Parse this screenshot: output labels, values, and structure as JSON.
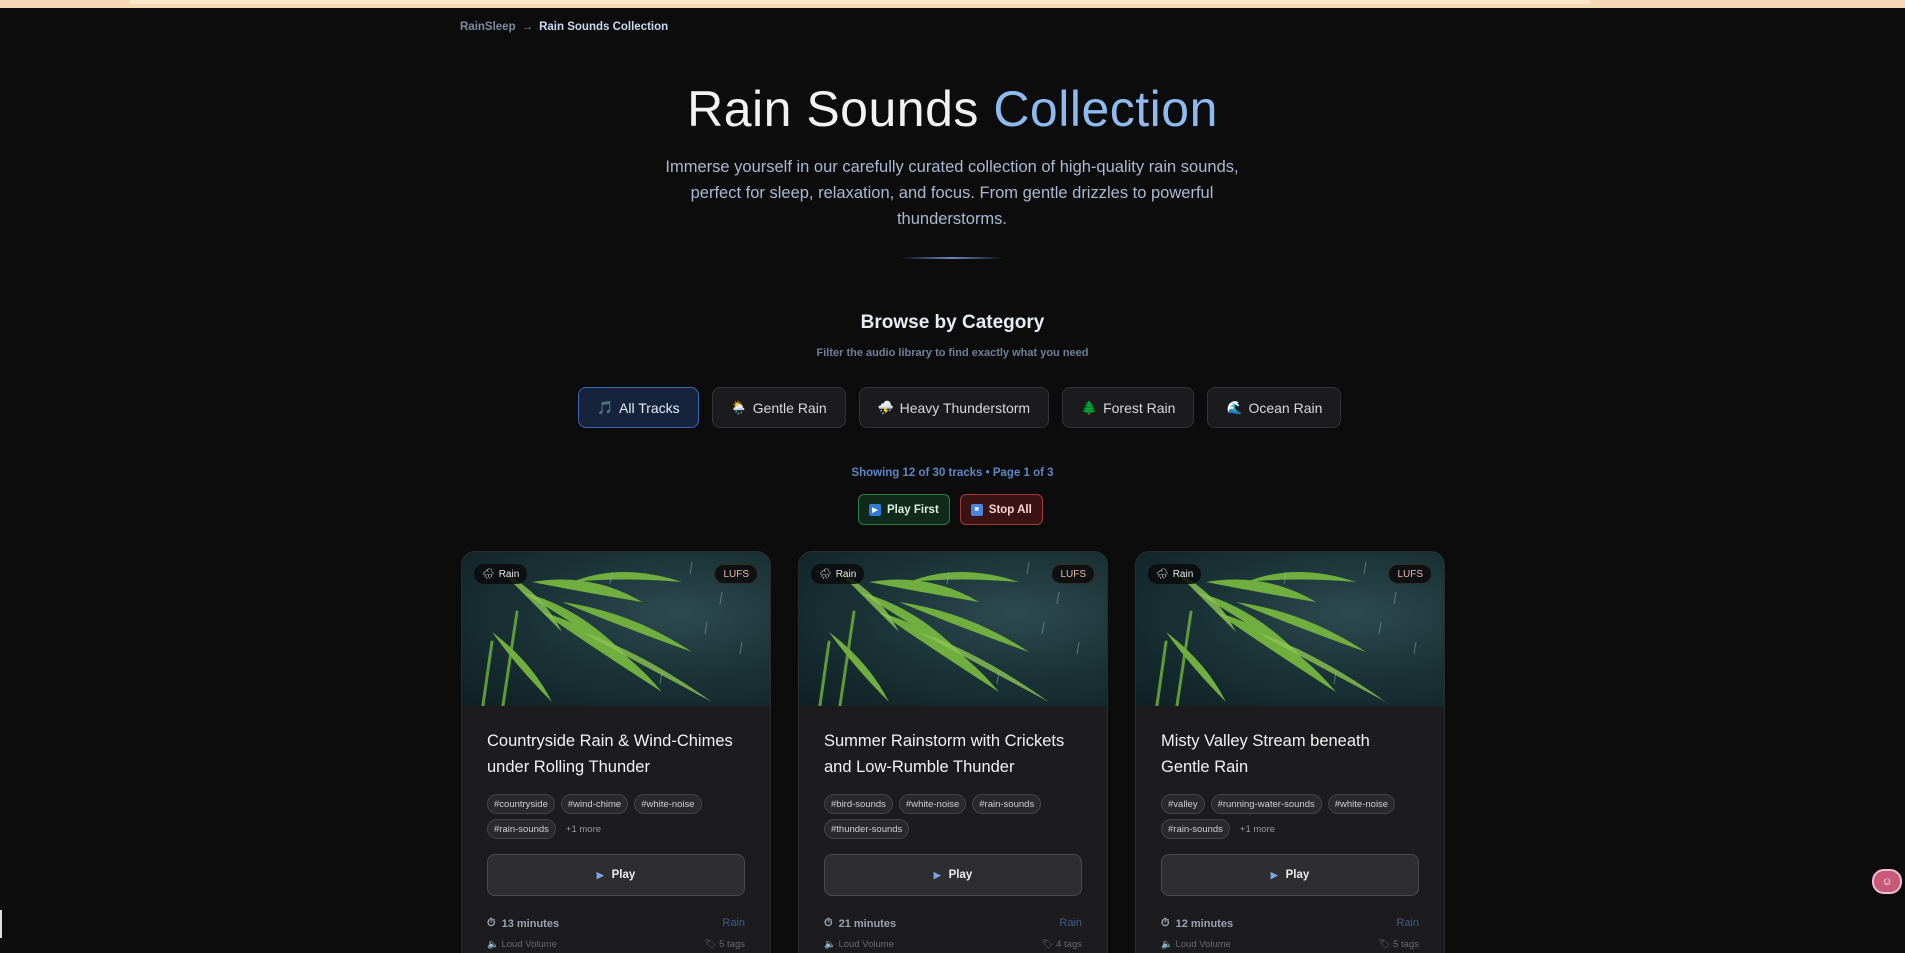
{
  "breadcrumb": {
    "home": "RainSleep",
    "separator": "→",
    "current": "Rain Sounds Collection"
  },
  "hero": {
    "title_main": "Rain Sounds",
    "title_accent": "Collection",
    "description": "Immerse yourself in our carefully curated collection of high-quality rain sounds, perfect for sleep, relaxation, and focus. From gentle drizzles to powerful thunderstorms."
  },
  "browse": {
    "title": "Browse by Category",
    "subtitle": "Filter the audio library to find exactly what you need",
    "categories": [
      {
        "icon": "🎵",
        "label": "All Tracks"
      },
      {
        "icon": "🌦️",
        "label": "Gentle Rain"
      },
      {
        "icon": "⛈️",
        "label": "Heavy Thunderstorm"
      },
      {
        "icon": "🌲",
        "label": "Forest Rain"
      },
      {
        "icon": "🌊",
        "label": "Ocean Rain"
      }
    ]
  },
  "status": {
    "showing": "Showing 12 of 30 tracks • Page 1 of 3"
  },
  "controls": {
    "play_first": "Play First",
    "stop_all": "Stop All"
  },
  "cards": [
    {
      "type_badge": "Rain",
      "lufs": "LUFS",
      "title": "Countryside Rain & Wind-Chimes under Rolling Thunder",
      "tags": [
        "#countryside",
        "#wind-chime",
        "#white-noise",
        "#rain-sounds"
      ],
      "more": "+1 more",
      "play": "Play",
      "duration": "13 minutes",
      "category": "Rain",
      "volume": "Loud Volume",
      "tag_count": "5 tags"
    },
    {
      "type_badge": "Rain",
      "lufs": "LUFS",
      "title": "Summer Rainstorm with Crickets and Low-Rumble Thunder",
      "tags": [
        "#bird-sounds",
        "#white-noise",
        "#rain-sounds",
        "#thunder-sounds"
      ],
      "more": "",
      "play": "Play",
      "duration": "21 minutes",
      "category": "Rain",
      "volume": "Loud Volume",
      "tag_count": "4 tags"
    },
    {
      "type_badge": "Rain",
      "lufs": "LUFS",
      "title": "Misty Valley Stream beneath Gentle Rain",
      "tags": [
        "#valley",
        "#running-water-sounds",
        "#white-noise",
        "#rain-sounds"
      ],
      "more": "+1 more",
      "play": "Play",
      "duration": "12 minutes",
      "category": "Rain",
      "volume": "Loud Volume",
      "tag_count": "5 tags"
    }
  ],
  "colors": {
    "accent": "#8fbaf0",
    "background": "#0c0c0c",
    "active_category": "#16233d"
  }
}
